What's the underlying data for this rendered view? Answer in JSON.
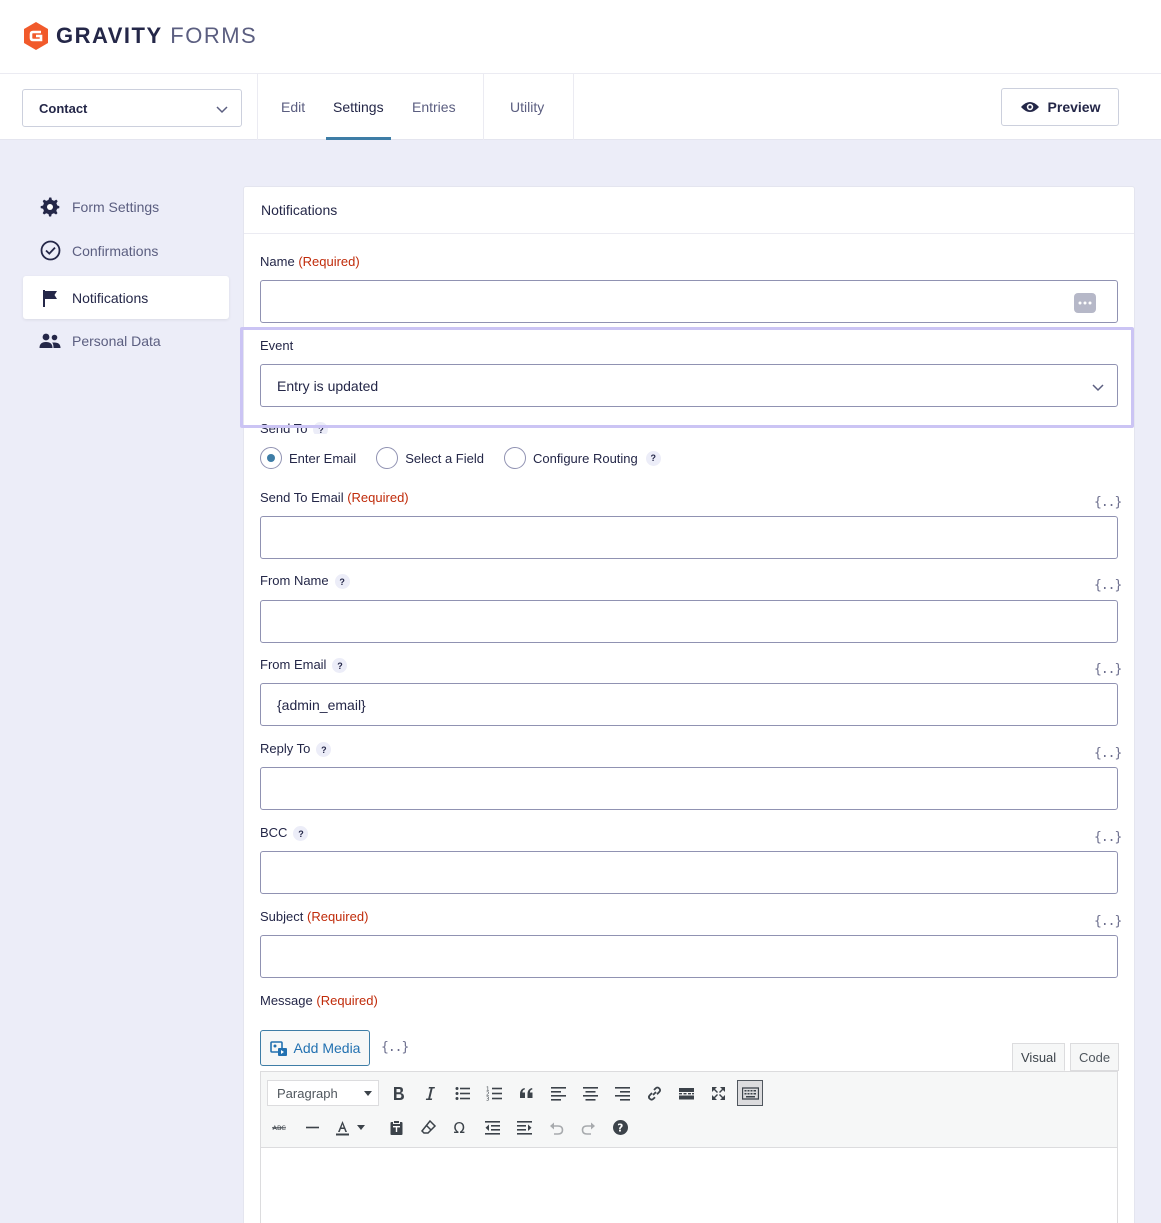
{
  "brand": {
    "bold": "GRAVITY",
    "light": "FORMS"
  },
  "toolbar": {
    "form_name": "Contact",
    "tabs": [
      {
        "label": "Edit"
      },
      {
        "label": "Settings",
        "active": true
      },
      {
        "label": "Entries"
      },
      {
        "label": "Utility"
      }
    ],
    "preview_label": "Preview"
  },
  "sidebar": {
    "items": [
      {
        "label": "Form Settings",
        "icon": "gear-icon"
      },
      {
        "label": "Confirmations",
        "icon": "check-circle-icon"
      },
      {
        "label": "Notifications",
        "icon": "flag-icon",
        "active": true
      },
      {
        "label": "Personal Data",
        "icon": "users-icon"
      }
    ]
  },
  "panel": {
    "title": "Notifications",
    "required_text": "(Required)",
    "help_text": "?",
    "merge_tag": "{..}",
    "name_label": "Name",
    "event_label": "Event",
    "event_value": "Entry is updated",
    "send_to_label": "Send To",
    "send_to_options": [
      {
        "label": "Enter Email",
        "checked": true
      },
      {
        "label": "Select a Field",
        "checked": false
      },
      {
        "label": "Configure Routing",
        "checked": false
      }
    ],
    "send_to_email_label": "Send To Email",
    "from_name_label": "From Name",
    "from_email_label": "From Email",
    "from_email_value": "{admin_email}",
    "reply_to_label": "Reply To",
    "bcc_label": "BCC",
    "subject_label": "Subject",
    "message_label": "Message"
  },
  "editor": {
    "add_media_label": "Add Media",
    "tab_visual": "Visual",
    "tab_code": "Code",
    "format_select": "Paragraph"
  },
  "colors": {
    "accent": "#3e7da6",
    "required": "#c02b0a",
    "highlight": "#cbc4f4",
    "brand": "#f15a2b"
  }
}
